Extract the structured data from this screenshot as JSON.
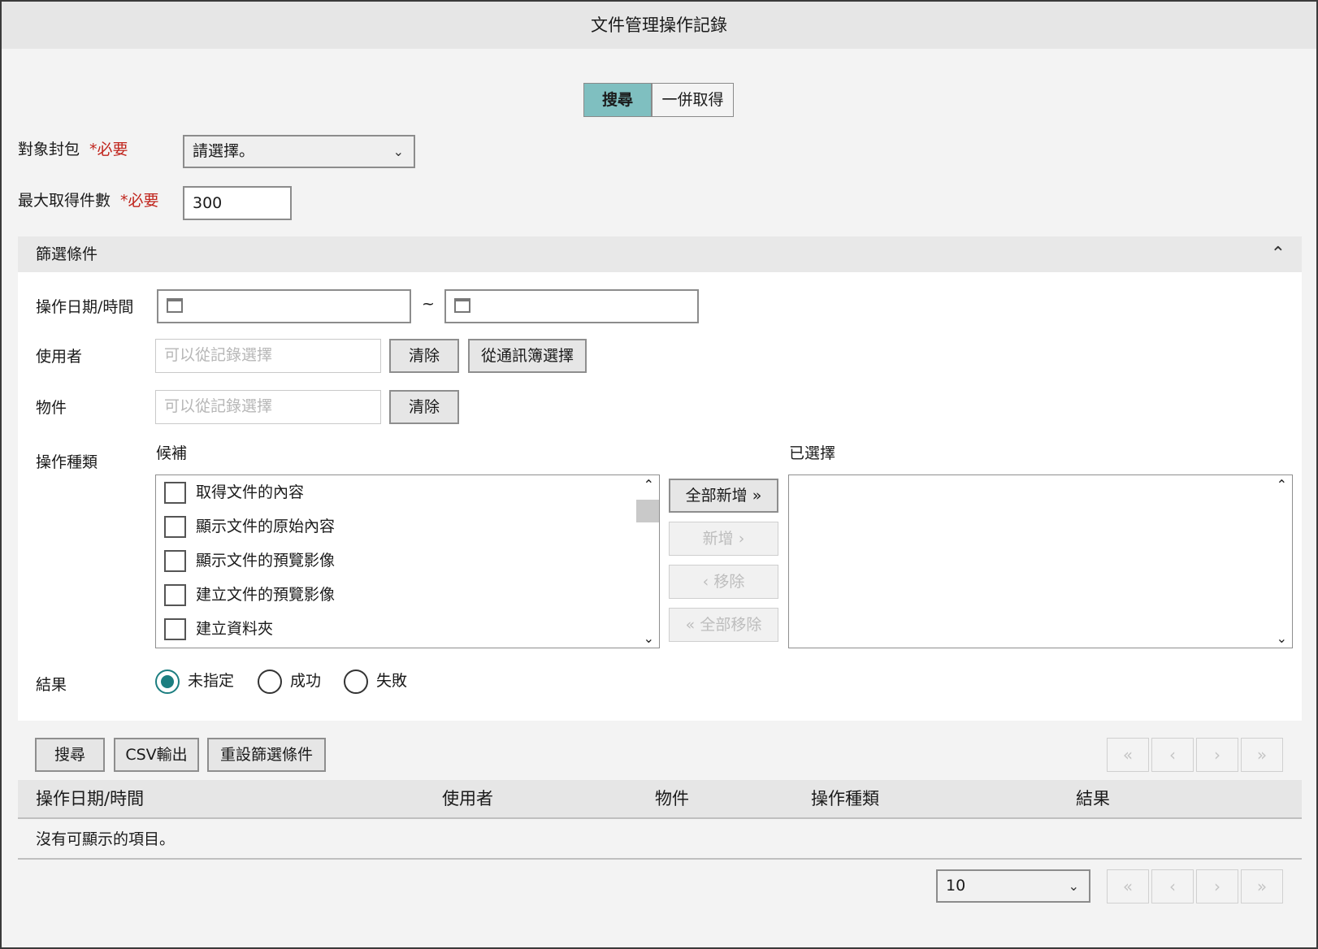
{
  "window": {
    "title": "文件管理操作記錄"
  },
  "mode_tabs": {
    "search": "搜尋",
    "batch": "一併取得"
  },
  "form": {
    "envelope": {
      "label": "對象封包",
      "required": "*必要",
      "value": "請選擇。"
    },
    "max_count": {
      "label": "最大取得件數",
      "required": "*必要",
      "value": "300"
    }
  },
  "filter": {
    "title": "篩選條件",
    "datetime": {
      "label": "操作日期/時間",
      "separator": "~"
    },
    "user": {
      "label": "使用者",
      "placeholder": "可以從記錄選擇",
      "clear": "清除",
      "from_directory": "從通訊簿選擇"
    },
    "object": {
      "label": "物件",
      "placeholder": "可以從記錄選擇",
      "clear": "清除"
    },
    "op_type": {
      "label": "操作種類",
      "candidates_label": "候補",
      "selected_label": "已選擇",
      "candidates": [
        "取得文件的內容",
        "顯示文件的原始內容",
        "顯示文件的預覽影像",
        "建立文件的預覽影像",
        "建立資料夾"
      ],
      "add_all": "全部新增",
      "add": "新增",
      "remove": "移除",
      "remove_all": "全部移除"
    },
    "result": {
      "label": "結果",
      "options": [
        "未指定",
        "成功",
        "失敗"
      ],
      "selected": "未指定"
    }
  },
  "actions": {
    "search": "搜尋",
    "csv": "CSV輸出",
    "reset": "重設篩選條件"
  },
  "table": {
    "columns": [
      "操作日期/時間",
      "使用者",
      "物件",
      "操作種類",
      "結果"
    ],
    "empty_message": "沒有可顯示的項目。"
  },
  "paging": {
    "page_size": "10"
  }
}
